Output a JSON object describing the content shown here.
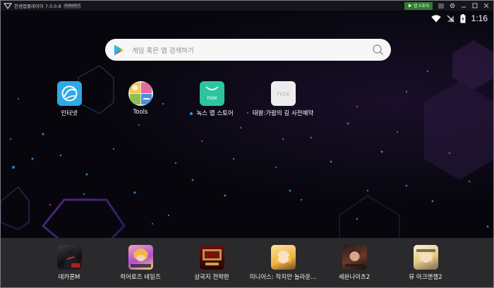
{
  "window": {
    "title": "한샘앱플레이어 7.0.0.8",
    "android_badge": "Android 7"
  },
  "titlebar": {
    "app_store_label": "앱 스토어",
    "icons": [
      "menu-icon",
      "gear-icon",
      "minimize-icon",
      "maximize-icon",
      "close-icon"
    ]
  },
  "status": {
    "time": "1:16",
    "icons": [
      "wifi-icon",
      "signal-icon",
      "battery-icon"
    ]
  },
  "search": {
    "placeholder": "게임 혹은 앱 검색하기"
  },
  "desktop_apps": [
    {
      "label": "인터넷",
      "icon": "internet-icon",
      "color": "#2fa9e6"
    },
    {
      "label": "Tools",
      "icon": "tools-icon",
      "color": "#e9e9e9"
    },
    {
      "label": "녹스 앱 스토어",
      "icon": "nox-store-icon",
      "color": "#2ec4a0"
    },
    {
      "label": "태왕:가람의 길 사전예약",
      "icon": "nox-icon",
      "color": "#ececec"
    }
  ],
  "dock_apps": [
    {
      "label": "데카론M",
      "icon": "dekaron-icon"
    },
    {
      "label": "히어로즈 테일즈",
      "icon": "heroes-tales-icon"
    },
    {
      "label": "삼국지 전략판",
      "icon": "three-kingdoms-icon"
    },
    {
      "label": "미니어스: 작지만 놀라운...",
      "icon": "miniers-icon"
    },
    {
      "label": "세븐나이츠2",
      "icon": "seven-knights-icon"
    },
    {
      "label": "뮤 아크엔젤2",
      "icon": "mu-archangel-icon"
    }
  ]
}
